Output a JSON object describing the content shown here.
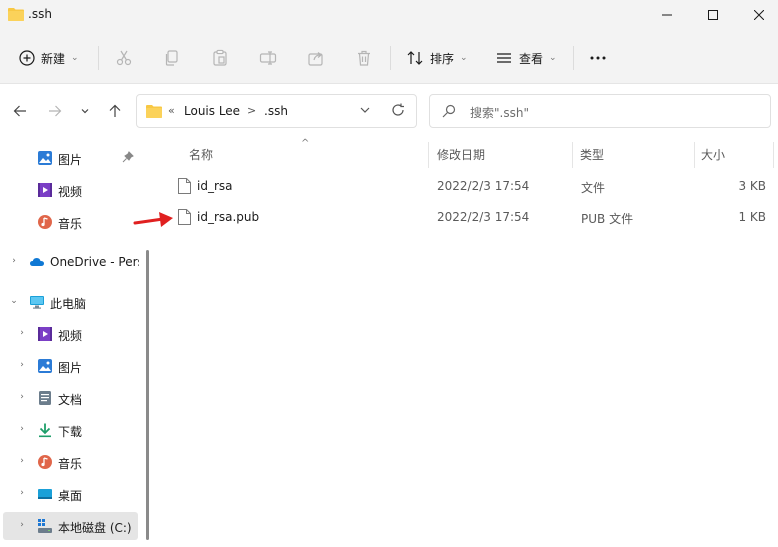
{
  "window": {
    "title": ".ssh",
    "icon": "folder-icon",
    "controls": [
      "minimize-icon",
      "maximize-icon",
      "close-icon"
    ]
  },
  "toolbar": {
    "new_label": "新建",
    "sort_label": "排序",
    "view_label": "查看",
    "more_label": "···",
    "icons": [
      "plus-circle-icon",
      "cut-icon",
      "copy-icon",
      "paste-icon",
      "rename-icon",
      "share-icon",
      "delete-icon",
      "sort-icon",
      "view-icon",
      "more-icon"
    ]
  },
  "address": {
    "overflow": "«",
    "segments": [
      "Louis Lee",
      ".ssh"
    ],
    "separator": ">"
  },
  "search": {
    "placeholder": "搜索\".ssh\""
  },
  "sidebar": {
    "quick": [
      {
        "label": "图片",
        "icon": "pictures-icon",
        "pinned": true
      },
      {
        "label": "视频",
        "icon": "videos-icon"
      },
      {
        "label": "音乐",
        "icon": "music-icon"
      }
    ],
    "onedrive": {
      "label": "OneDrive - Pers",
      "icon": "cloud-icon"
    },
    "thispc": {
      "label": "此电脑",
      "icon": "computer-icon"
    },
    "pc_items": [
      {
        "label": "视频",
        "icon": "videos-icon"
      },
      {
        "label": "图片",
        "icon": "pictures-icon"
      },
      {
        "label": "文档",
        "icon": "documents-icon"
      },
      {
        "label": "下载",
        "icon": "download-icon"
      },
      {
        "label": "音乐",
        "icon": "music-icon"
      },
      {
        "label": "桌面",
        "icon": "desktop-icon"
      },
      {
        "label": "本地磁盘 (C:)",
        "icon": "drive-icon",
        "selected": true
      }
    ]
  },
  "columns": {
    "name": "名称",
    "modified": "修改日期",
    "type": "类型",
    "size": "大小"
  },
  "files": [
    {
      "name": "id_rsa",
      "modified": "2022/2/3 17:54",
      "type": "文件",
      "size": "3 KB"
    },
    {
      "name": "id_rsa.pub",
      "modified": "2022/2/3 17:54",
      "type": "PUB 文件",
      "size": "1 KB"
    }
  ],
  "colors": {
    "folder": "#f8c844",
    "accent_red": "#e02020",
    "chrome_bg": "#f3f3f3",
    "selected_bg": "#e5e5e5"
  }
}
